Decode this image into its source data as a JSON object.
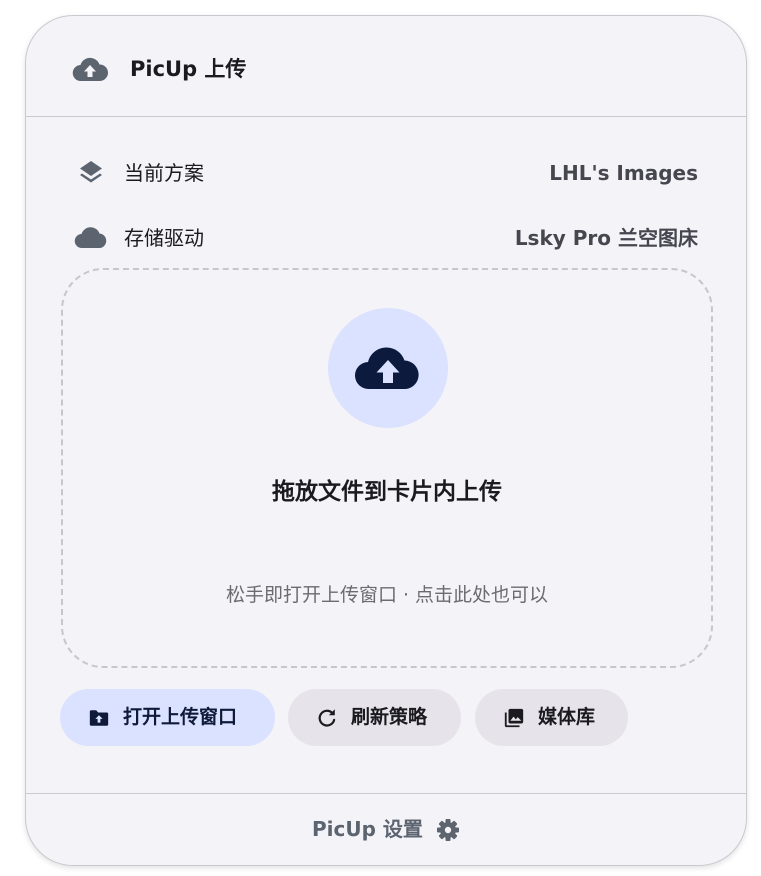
{
  "header": {
    "icon": "cloud-upload-icon",
    "title": "PicUp 上传"
  },
  "info": [
    {
      "icon": "layers-icon",
      "label": "当前方案",
      "value": "LHL's Images"
    },
    {
      "icon": "cloud-icon",
      "label": "存储驱动",
      "value": "Lsky Pro 兰空图床"
    }
  ],
  "dropzone": {
    "icon": "cloud-upload-icon",
    "title": "拖放文件到卡片内上传",
    "hint": "松手即打开上传窗口 · 点击此处也可以"
  },
  "actions": {
    "open_upload": {
      "icon": "folder-upload-icon",
      "label": "打开上传窗口"
    },
    "refresh": {
      "icon": "refresh-icon",
      "label": "刷新策略"
    },
    "media": {
      "icon": "photo-library-icon",
      "label": "媒体库"
    }
  },
  "footer": {
    "label": "PicUp 设置",
    "icon": "gear-icon"
  },
  "colors": {
    "card_bg": "#f4f3f8",
    "accent_container": "#dbe2ff",
    "accent_dark": "#0f1a3a",
    "icon_gray": "#5c6470",
    "tonal_button": "#e6e4ea"
  }
}
